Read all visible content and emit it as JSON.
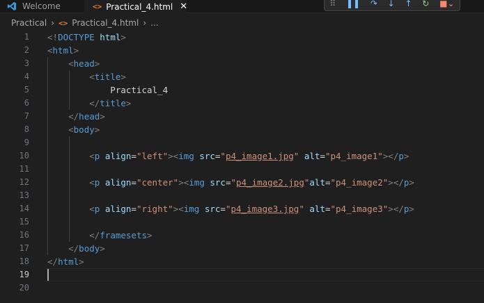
{
  "tabs": {
    "welcome_label": "Welcome",
    "active_label": "Practical_4.html",
    "close_glyph": "✕"
  },
  "toolbar": {
    "items": [
      "drag-handle",
      "pause",
      "step-over",
      "step-into",
      "step-out",
      "restart",
      "stop"
    ]
  },
  "breadcrumb": {
    "folder": "Practical",
    "file": "Practical_4.html",
    "more": "..."
  },
  "editor": {
    "active_line": 19,
    "lines": [
      {
        "n": "1",
        "tokens": [
          [
            "bracket",
            "<!"
          ],
          [
            "tag",
            "DOCTYPE"
          ],
          [
            "text",
            " "
          ],
          [
            "attr",
            "html"
          ],
          [
            "bracket",
            ">"
          ]
        ]
      },
      {
        "n": "2",
        "tokens": [
          [
            "bracket",
            "<"
          ],
          [
            "tag",
            "html"
          ],
          [
            "bracket",
            ">"
          ]
        ]
      },
      {
        "n": "3",
        "tokens": [
          [
            "text",
            "    "
          ],
          [
            "bracket",
            "<"
          ],
          [
            "tag",
            "head"
          ],
          [
            "bracket",
            ">"
          ]
        ]
      },
      {
        "n": "4",
        "tokens": [
          [
            "text",
            "        "
          ],
          [
            "bracket",
            "<"
          ],
          [
            "tag",
            "title"
          ],
          [
            "bracket",
            ">"
          ]
        ]
      },
      {
        "n": "5",
        "tokens": [
          [
            "text",
            "            Practical_4"
          ]
        ]
      },
      {
        "n": "6",
        "tokens": [
          [
            "text",
            "        "
          ],
          [
            "bracket",
            "</"
          ],
          [
            "tag",
            "title"
          ],
          [
            "bracket",
            ">"
          ]
        ]
      },
      {
        "n": "7",
        "tokens": [
          [
            "text",
            "    "
          ],
          [
            "bracket",
            "</"
          ],
          [
            "tag",
            "head"
          ],
          [
            "bracket",
            ">"
          ]
        ]
      },
      {
        "n": "8",
        "tokens": [
          [
            "text",
            "    "
          ],
          [
            "bracket",
            "<"
          ],
          [
            "tag",
            "body"
          ],
          [
            "bracket",
            ">"
          ]
        ]
      },
      {
        "n": "9",
        "tokens": []
      },
      {
        "n": "10",
        "tokens": [
          [
            "text",
            "        "
          ],
          [
            "bracket",
            "<"
          ],
          [
            "tag",
            "p"
          ],
          [
            "text",
            " "
          ],
          [
            "attr",
            "align"
          ],
          [
            "text",
            "="
          ],
          [
            "str",
            "\"left\""
          ],
          [
            "bracket",
            ">"
          ],
          [
            "bracket",
            "<"
          ],
          [
            "tag",
            "img"
          ],
          [
            "text",
            " "
          ],
          [
            "attr",
            "src"
          ],
          [
            "text",
            "="
          ],
          [
            "str",
            "\""
          ],
          [
            "link",
            "p4_image1.jpg"
          ],
          [
            "str",
            "\""
          ],
          [
            "text",
            " "
          ],
          [
            "attr",
            "alt"
          ],
          [
            "text",
            "="
          ],
          [
            "str",
            "\"p4_image1\""
          ],
          [
            "bracket",
            ">"
          ],
          [
            "bracket",
            "</"
          ],
          [
            "tag",
            "p"
          ],
          [
            "bracket",
            ">"
          ]
        ]
      },
      {
        "n": "11",
        "tokens": []
      },
      {
        "n": "12",
        "tokens": [
          [
            "text",
            "        "
          ],
          [
            "bracket",
            "<"
          ],
          [
            "tag",
            "p"
          ],
          [
            "text",
            " "
          ],
          [
            "attr",
            "align"
          ],
          [
            "text",
            "="
          ],
          [
            "str",
            "\"center\""
          ],
          [
            "bracket",
            ">"
          ],
          [
            "bracket",
            "<"
          ],
          [
            "tag",
            "img"
          ],
          [
            "text",
            " "
          ],
          [
            "attr",
            "src"
          ],
          [
            "text",
            "="
          ],
          [
            "str",
            "\""
          ],
          [
            "link",
            "p4_image2.jpg"
          ],
          [
            "str",
            "\""
          ],
          [
            "attr",
            "alt"
          ],
          [
            "text",
            "="
          ],
          [
            "str",
            "\"p4_image2\""
          ],
          [
            "bracket",
            ">"
          ],
          [
            "bracket",
            "</"
          ],
          [
            "tag",
            "p"
          ],
          [
            "bracket",
            ">"
          ]
        ]
      },
      {
        "n": "13",
        "tokens": []
      },
      {
        "n": "14",
        "tokens": [
          [
            "text",
            "        "
          ],
          [
            "bracket",
            "<"
          ],
          [
            "tag",
            "p"
          ],
          [
            "text",
            " "
          ],
          [
            "attr",
            "align"
          ],
          [
            "text",
            "="
          ],
          [
            "str",
            "\"right\""
          ],
          [
            "bracket",
            ">"
          ],
          [
            "bracket",
            "<"
          ],
          [
            "tag",
            "img"
          ],
          [
            "text",
            " "
          ],
          [
            "attr",
            "src"
          ],
          [
            "text",
            "="
          ],
          [
            "str",
            "\""
          ],
          [
            "link",
            "p4_image3.jpg"
          ],
          [
            "str",
            "\""
          ],
          [
            "text",
            " "
          ],
          [
            "attr",
            "alt"
          ],
          [
            "text",
            "="
          ],
          [
            "str",
            "\"p4_image3\""
          ],
          [
            "bracket",
            ">"
          ],
          [
            "bracket",
            "</"
          ],
          [
            "tag",
            "p"
          ],
          [
            "bracket",
            ">"
          ]
        ]
      },
      {
        "n": "15",
        "tokens": []
      },
      {
        "n": "16",
        "tokens": [
          [
            "text",
            "        "
          ],
          [
            "bracket",
            "</"
          ],
          [
            "tag",
            "framesets"
          ],
          [
            "bracket",
            ">"
          ]
        ]
      },
      {
        "n": "17",
        "tokens": [
          [
            "text",
            "    "
          ],
          [
            "bracket",
            "</"
          ],
          [
            "tag",
            "body"
          ],
          [
            "bracket",
            ">"
          ]
        ]
      },
      {
        "n": "18",
        "tokens": [
          [
            "bracket",
            "</"
          ],
          [
            "tag",
            "html"
          ],
          [
            "bracket",
            ">"
          ]
        ]
      },
      {
        "n": "19",
        "tokens": []
      },
      {
        "n": "20",
        "tokens": []
      }
    ]
  },
  "colors": {
    "background": "#1f1f1f",
    "tag": "#569cd6",
    "attribute": "#9cdcfe",
    "string": "#ce9178",
    "bracket": "#808080"
  }
}
